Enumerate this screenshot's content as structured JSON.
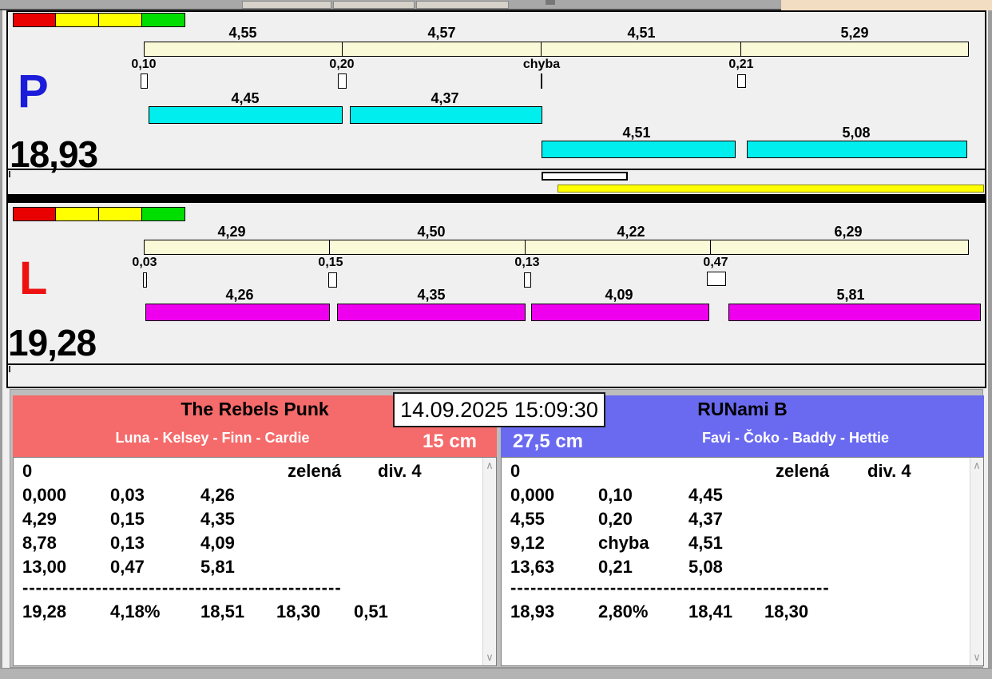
{
  "icons": {
    "scroll_up": "∧",
    "scroll_down": "∨"
  },
  "colors": {
    "panel_bg": "#f0f0f0",
    "sector_bar": "#fafad8",
    "lane_p_bar": "#00eeee",
    "lane_l_bar": "#ee00ee",
    "overall_bar": "#ffff00",
    "traffic_lights": [
      "#e90000",
      "#ffff00",
      "#ffff00",
      "#00dd00"
    ],
    "team_left_header": "#f56a6a",
    "team_right_header": "#6a6af0",
    "letter_p": "#1c1cdb",
    "letter_l": "#ee1111",
    "top_strip_right": "#f2dcc2"
  },
  "lanes": [
    {
      "letter": "P",
      "total": "18,93",
      "upper_segments": [
        "4,55",
        "4,57",
        "4,51",
        "5,29"
      ],
      "splits": [
        "0,10",
        "0,20",
        "chyba",
        "0,21"
      ],
      "run_labels": [
        "4,45",
        "4,37",
        "4,51",
        "5,08"
      ]
    },
    {
      "letter": "L",
      "total": "19,28",
      "upper_segments": [
        "4,29",
        "4,50",
        "4,22",
        "6,29"
      ],
      "splits": [
        "0,03",
        "0,15",
        "0,13",
        "0,47"
      ],
      "run_labels": [
        "4,26",
        "4,35",
        "4,09",
        "5,81"
      ]
    }
  ],
  "footer": {
    "datetime": "14.09.2025 15:09:30",
    "left": {
      "team": "The Rebels Punk",
      "members": "Luna - Kelsey - Finn - Cardie",
      "height": "15 cm",
      "info": {
        "start": "0",
        "status": "zelená",
        "division": "div. 4"
      },
      "rows": [
        [
          "0,000",
          "0,03",
          "4,26"
        ],
        [
          "4,29",
          "0,15",
          "4,35"
        ],
        [
          "8,78",
          "0,13",
          "4,09"
        ],
        [
          "13,00",
          "0,47",
          "5,81"
        ]
      ],
      "separator": "------------------------------------------------",
      "summary": [
        "19,28",
        "4,18%",
        "18,51",
        "18,30",
        "0,51"
      ]
    },
    "right": {
      "team": "RUNami B",
      "members": "Favi - Čoko - Baddy - Hettie",
      "height": "27,5 cm",
      "info": {
        "start": "0",
        "status": "zelená",
        "division": "div. 4"
      },
      "rows": [
        [
          "0,000",
          "0,10",
          "4,45"
        ],
        [
          "4,55",
          "0,20",
          "4,37"
        ],
        [
          "9,12",
          "chyba",
          "4,51"
        ],
        [
          "13,63",
          "0,21",
          "5,08"
        ]
      ],
      "separator": "------------------------------------------------",
      "summary": [
        "18,93",
        "2,80%",
        "18,41",
        "18,30"
      ]
    }
  }
}
